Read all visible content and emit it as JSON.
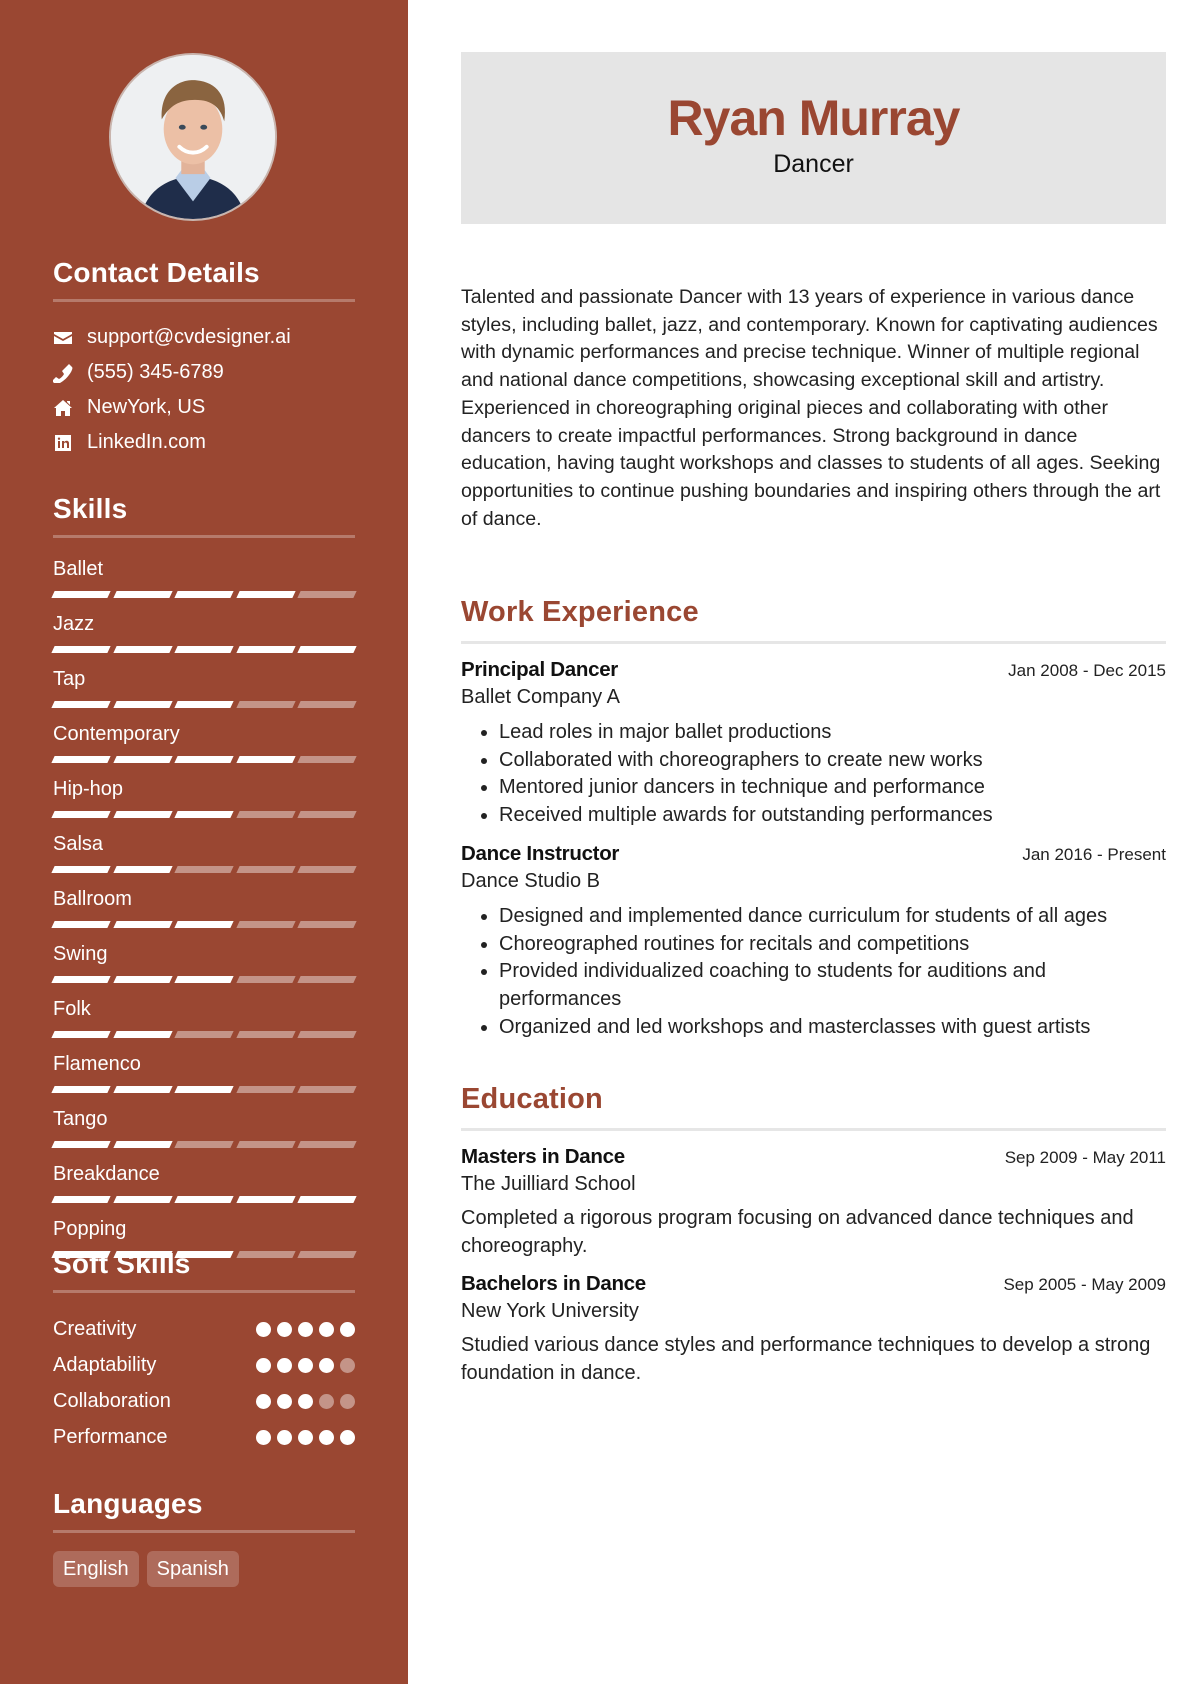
{
  "profile": {
    "name": "Ryan Murray",
    "title": "Dancer",
    "photo_alt": "Profile photo of Ryan Murray"
  },
  "colors": {
    "accent": "#9a4732",
    "header_bg": "#e5e5e5",
    "text": "#222222"
  },
  "contact": {
    "heading": "Contact Details",
    "items": [
      {
        "icon": "envelope-icon",
        "text": "support@cvdesigner.ai"
      },
      {
        "icon": "phone-icon",
        "text": "(555) 345-6789"
      },
      {
        "icon": "home-icon",
        "text": "NewYork, US"
      },
      {
        "icon": "linkedin-icon",
        "text": "LinkedIn.com"
      }
    ]
  },
  "skills": {
    "heading": "Skills",
    "max_level": 5,
    "items": [
      {
        "label": "Ballet",
        "level": 4
      },
      {
        "label": "Jazz",
        "level": 5
      },
      {
        "label": "Tap",
        "level": 3
      },
      {
        "label": "Contemporary",
        "level": 4
      },
      {
        "label": "Hip-hop",
        "level": 3
      },
      {
        "label": "Salsa",
        "level": 2
      },
      {
        "label": "Ballroom",
        "level": 3
      },
      {
        "label": "Swing",
        "level": 3
      },
      {
        "label": "Folk",
        "level": 2
      },
      {
        "label": "Flamenco",
        "level": 3
      },
      {
        "label": "Tango",
        "level": 2
      },
      {
        "label": "Breakdance",
        "level": 5
      },
      {
        "label": "Popping",
        "level": 3
      }
    ]
  },
  "soft_skills": {
    "heading": "Soft Skills",
    "max_level": 5,
    "items": [
      {
        "label": "Creativity",
        "level": 5
      },
      {
        "label": "Adaptability",
        "level": 4
      },
      {
        "label": "Collaboration",
        "level": 3
      },
      {
        "label": "Performance",
        "level": 5
      }
    ]
  },
  "languages": {
    "heading": "Languages",
    "items": [
      "English",
      "Spanish"
    ]
  },
  "summary": "Talented and passionate Dancer with 13 years of experience in various dance styles, including ballet, jazz, and contemporary. Known for captivating audiences with dynamic performances and precise technique. Winner of multiple regional and national dance competitions, showcasing exceptional skill and artistry. Experienced in choreographing original pieces and collaborating with other dancers to create impactful performances. Strong background in dance education, having taught workshops and classes to students of all ages. Seeking opportunities to continue pushing boundaries and inspiring others through the art of dance.",
  "work": {
    "heading": "Work Experience",
    "entries": [
      {
        "title": "Principal Dancer",
        "org": "Ballet Company A",
        "date": "Jan 2008 - Dec 2015",
        "bullets": [
          "Lead roles in major ballet productions",
          "Collaborated with choreographers to create new works",
          "Mentored junior dancers in technique and performance",
          "Received multiple awards for outstanding performances"
        ]
      },
      {
        "title": "Dance Instructor",
        "org": "Dance Studio B",
        "date": "Jan 2016 - Present",
        "bullets": [
          "Designed and implemented dance curriculum for students of all ages",
          "Choreographed routines for recitals and competitions",
          "Provided individualized coaching to students for auditions and performances",
          "Organized and led workshops and masterclasses with guest artists"
        ]
      }
    ]
  },
  "education": {
    "heading": "Education",
    "entries": [
      {
        "title": "Masters in Dance",
        "org": "The Juilliard School",
        "date": "Sep 2009 - May 2011",
        "description": "Completed a rigorous program focusing on advanced dance techniques and choreography."
      },
      {
        "title": "Bachelors in Dance",
        "org": "New York University",
        "date": "Sep 2005 - May 2009",
        "description": "Studied various dance styles and performance techniques to develop a strong foundation in dance."
      }
    ]
  }
}
